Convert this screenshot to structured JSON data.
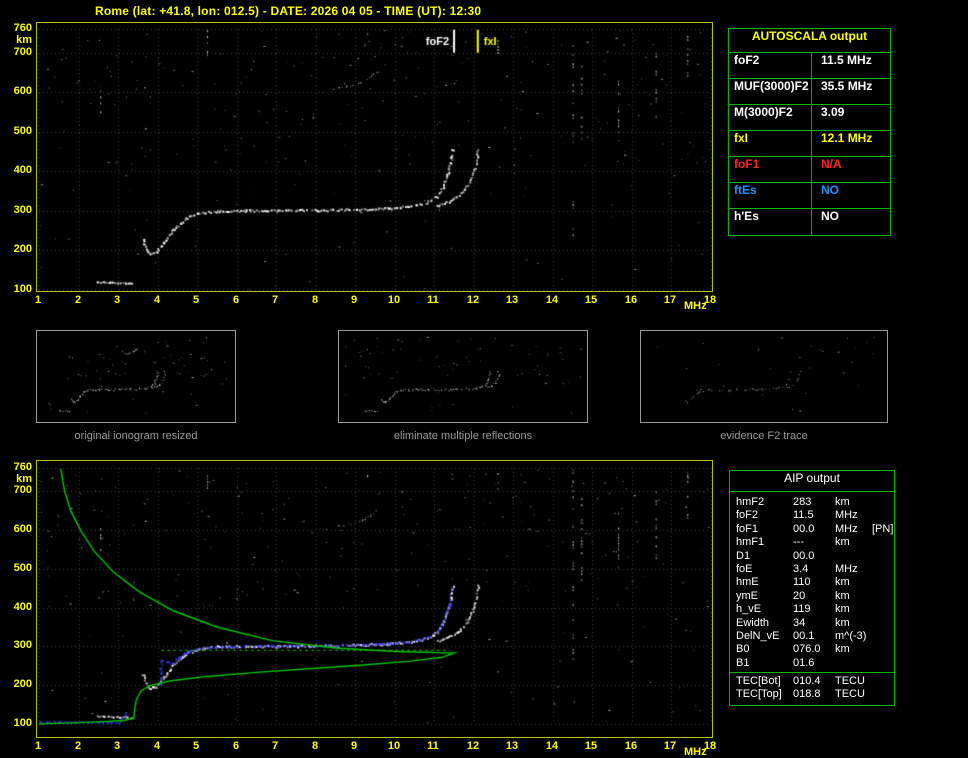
{
  "title": "Rome (lat: +41.8, lon: 012.5) - DATE: 2026 04 05 - TIME (UT): 12:30",
  "colors": {
    "background": "#000000",
    "accent_yellow": "#ffff00",
    "plot_border": "#bcbc00",
    "table_green": "#00b400",
    "profile_green": "#00c800",
    "restored_blue": "#4040ff",
    "restored_blue_dark": "#2a35d0",
    "status_red": "#ff2020",
    "status_blue": "#2090ff",
    "caption_gray": "#9a9a9a",
    "grid_gray": "#3c3c3c"
  },
  "autoscala_table": {
    "header": "AUTOSCALA output",
    "rows": [
      {
        "label": "foF2",
        "value": "11.5 MHz",
        "color": "#ffffff"
      },
      {
        "label": "MUF(3000)F2",
        "value": "35.5 MHz",
        "color": "#ffffff"
      },
      {
        "label": "M(3000)F2",
        "value": "3.09",
        "color": "#ffffff"
      },
      {
        "label": "fxI",
        "value": "12.1 MHz",
        "color": "#ffff00"
      },
      {
        "label": "foF1",
        "value": "N/A",
        "color": "#ff2020"
      },
      {
        "label": "ftEs",
        "value": "NO",
        "color": "#2090ff"
      },
      {
        "label": "h'Es",
        "value": "NO",
        "color": "#ffffff"
      }
    ]
  },
  "aip_table": {
    "header": "AIP output",
    "rows": [
      {
        "label": "hmF2",
        "value": "283",
        "unit": "km",
        "note": ""
      },
      {
        "label": "foF2",
        "value": "11.5",
        "unit": "MHz",
        "note": ""
      },
      {
        "label": "foF1",
        "value": "00.0",
        "unit": "MHz",
        "note": "[PN]"
      },
      {
        "label": "hmF1",
        "value": "---",
        "unit": "km",
        "note": ""
      },
      {
        "label": "D1",
        "value": "00.0",
        "unit": "",
        "note": ""
      },
      {
        "label": "foE",
        "value": "3.4",
        "unit": "MHz",
        "note": ""
      },
      {
        "label": "hmE",
        "value": "110",
        "unit": "km",
        "note": ""
      },
      {
        "label": "ymE",
        "value": "20",
        "unit": "km",
        "note": ""
      },
      {
        "label": "h_vE",
        "value": "119",
        "unit": "km",
        "note": ""
      },
      {
        "label": "Ewidth",
        "value": "34",
        "unit": "km",
        "note": ""
      },
      {
        "label": "DelN_vE",
        "value": "00.1",
        "unit": "m^(-3)",
        "note": ""
      },
      {
        "label": "B0",
        "value": "076.0",
        "unit": "km",
        "note": ""
      },
      {
        "label": "B1",
        "value": "01.6",
        "unit": "",
        "note": ""
      }
    ],
    "tec_rows": [
      {
        "label": "TEC[Bot]",
        "value": "010.4",
        "unit": "TECU"
      },
      {
        "label": "TEC[Top]",
        "value": "018.8",
        "unit": "TECU"
      }
    ]
  },
  "thumbnails": [
    {
      "caption": "original ionogram resized",
      "mode": "all"
    },
    {
      "caption": "eliminate multiple reflections",
      "mode": "no_multiples"
    },
    {
      "caption": "evidence F2 trace",
      "mode": "f2_only"
    }
  ],
  "chart_data": {
    "type": "scatter",
    "title": "ionogram",
    "x_axis": {
      "label": "MHz",
      "min": 1,
      "max": 18,
      "ticks": [
        1,
        2,
        3,
        4,
        5,
        6,
        7,
        8,
        9,
        10,
        11,
        12,
        13,
        14,
        15,
        16,
        17,
        18
      ]
    },
    "y_axis": {
      "label": "km",
      "min": 100,
      "max": 760,
      "ticks": [
        760,
        700,
        600,
        500,
        400,
        300,
        200,
        100
      ]
    },
    "markers": [
      {
        "label": "foF2",
        "f": 11.5,
        "km": [
          700,
          758
        ],
        "color": "#ffffff",
        "label_side": "left"
      },
      {
        "label": "fxI",
        "f": 12.1,
        "km": [
          700,
          758
        ],
        "color": "#ffff00",
        "label_side": "right"
      }
    ],
    "traces": {
      "e_region": [
        [
          2.45,
          122
        ],
        [
          3.35,
          118
        ]
      ],
      "f2_ordinary": [
        [
          3.62,
          230
        ],
        [
          3.7,
          205
        ],
        [
          3.8,
          194
        ],
        [
          3.95,
          198
        ],
        [
          4.15,
          222
        ],
        [
          4.4,
          255
        ],
        [
          4.7,
          282
        ],
        [
          5.0,
          295
        ],
        [
          5.5,
          301
        ],
        [
          6.2,
          302
        ],
        [
          7.0,
          302
        ],
        [
          8.0,
          303
        ],
        [
          9.0,
          305
        ],
        [
          9.8,
          308
        ],
        [
          10.4,
          313
        ],
        [
          10.8,
          322
        ],
        [
          11.05,
          338
        ],
        [
          11.2,
          360
        ],
        [
          11.32,
          392
        ],
        [
          11.4,
          425
        ],
        [
          11.45,
          458
        ]
      ],
      "f2_extraordinary": [
        [
          11.05,
          315
        ],
        [
          11.35,
          325
        ],
        [
          11.6,
          340
        ],
        [
          11.8,
          362
        ],
        [
          11.95,
          392
        ],
        [
          12.05,
          425
        ],
        [
          12.1,
          460
        ]
      ],
      "multiple_reflection": [
        [
          8.55,
          612
        ],
        [
          8.85,
          616
        ],
        [
          9.15,
          626
        ],
        [
          9.4,
          640
        ],
        [
          9.55,
          652
        ]
      ],
      "restored_trace": [
        [
          4.08,
          198
        ],
        [
          4.06,
          232
        ],
        [
          4.1,
          266
        ],
        [
          4.35,
          258
        ],
        [
          4.65,
          283
        ],
        [
          5.0,
          296
        ],
        [
          5.6,
          301
        ],
        [
          6.5,
          302
        ],
        [
          7.5,
          303
        ],
        [
          8.5,
          304
        ],
        [
          9.5,
          307
        ],
        [
          10.3,
          312
        ],
        [
          10.8,
          323
        ],
        [
          11.1,
          345
        ],
        [
          11.25,
          375
        ],
        [
          11.37,
          412
        ],
        [
          11.43,
          450
        ]
      ],
      "e_restored": [
        [
          1.0,
          108
        ],
        [
          1.7,
          107
        ],
        [
          2.5,
          106
        ],
        [
          3.0,
          105
        ],
        [
          3.1,
          115
        ],
        [
          3.18,
          130
        ]
      ],
      "profile": [
        [
          1.55,
          758
        ],
        [
          1.65,
          700
        ],
        [
          1.8,
          650
        ],
        [
          2.05,
          600
        ],
        [
          2.4,
          545
        ],
        [
          2.9,
          490
        ],
        [
          3.55,
          440
        ],
        [
          4.4,
          392
        ],
        [
          5.5,
          350
        ],
        [
          6.9,
          315
        ],
        [
          8.5,
          296
        ],
        [
          10.0,
          287
        ],
        [
          11.5,
          283
        ],
        [
          11.2,
          272
        ],
        [
          10.4,
          262
        ],
        [
          9.2,
          252
        ],
        [
          7.9,
          243
        ],
        [
          6.5,
          233
        ],
        [
          5.2,
          222
        ],
        [
          4.3,
          211
        ],
        [
          3.8,
          199
        ],
        [
          3.58,
          185
        ],
        [
          3.46,
          162
        ],
        [
          3.42,
          138
        ],
        [
          3.4,
          115
        ],
        [
          3.15,
          109
        ],
        [
          2.6,
          106
        ],
        [
          1.9,
          103
        ],
        [
          1.2,
          101
        ],
        [
          1.0,
          100
        ]
      ],
      "hmf2_level": [
        [
          4.1,
          290
        ],
        [
          11.4,
          290
        ]
      ]
    },
    "noise_columns": [
      {
        "f": 5.25,
        "km": [
          690,
          757
        ],
        "density": 0.6
      },
      {
        "f": 14.5,
        "km": [
          240,
          757
        ],
        "density": 0.3
      },
      {
        "f": 14.72,
        "km": [
          470,
          690
        ],
        "density": 0.35
      },
      {
        "f": 15.65,
        "km": [
          500,
          645
        ],
        "density": 0.45
      },
      {
        "f": 16.6,
        "km": [
          520,
          700
        ],
        "density": 0.35
      },
      {
        "f": 17.4,
        "km": [
          630,
          750
        ],
        "density": 0.5
      },
      {
        "f": 12.6,
        "km": [
          700,
          755
        ],
        "density": 0.5
      },
      {
        "f": 2.55,
        "km": [
          545,
          605
        ],
        "density": 0.4
      },
      {
        "f": 9.3,
        "km": [
          730,
          757
        ],
        "density": 0.5
      }
    ]
  }
}
